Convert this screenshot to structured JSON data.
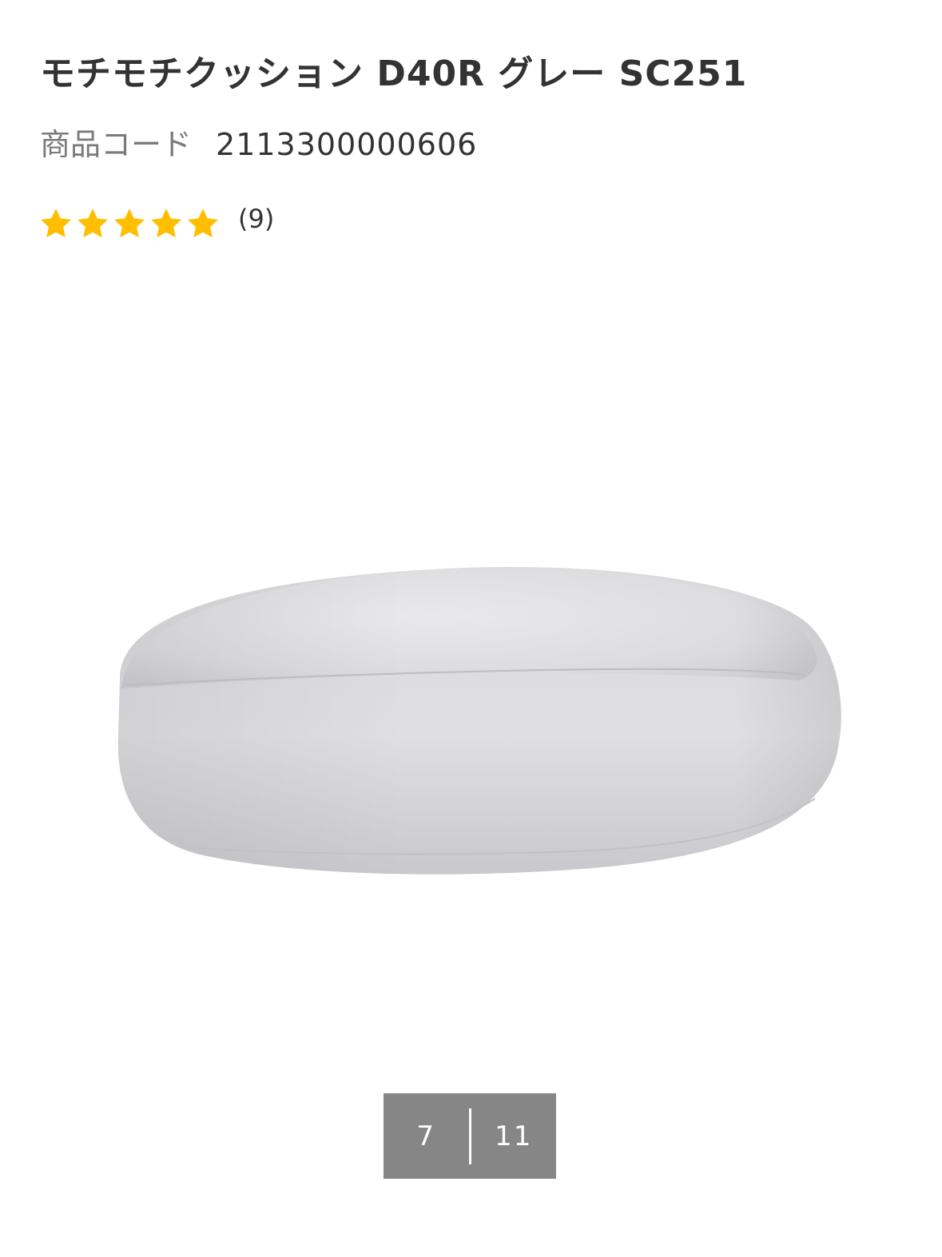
{
  "product": {
    "title": "モチモチクッション D40R グレー SC251",
    "code_label": "商品コード",
    "code_value": "2113300000606"
  },
  "rating": {
    "stars": 5,
    "max_stars": 5,
    "review_count": "(9)",
    "star_color": "#FFBE00"
  },
  "image": {
    "subject": "gray round cushion"
  },
  "pager": {
    "current": "7",
    "total": "11",
    "background": "#868686"
  }
}
